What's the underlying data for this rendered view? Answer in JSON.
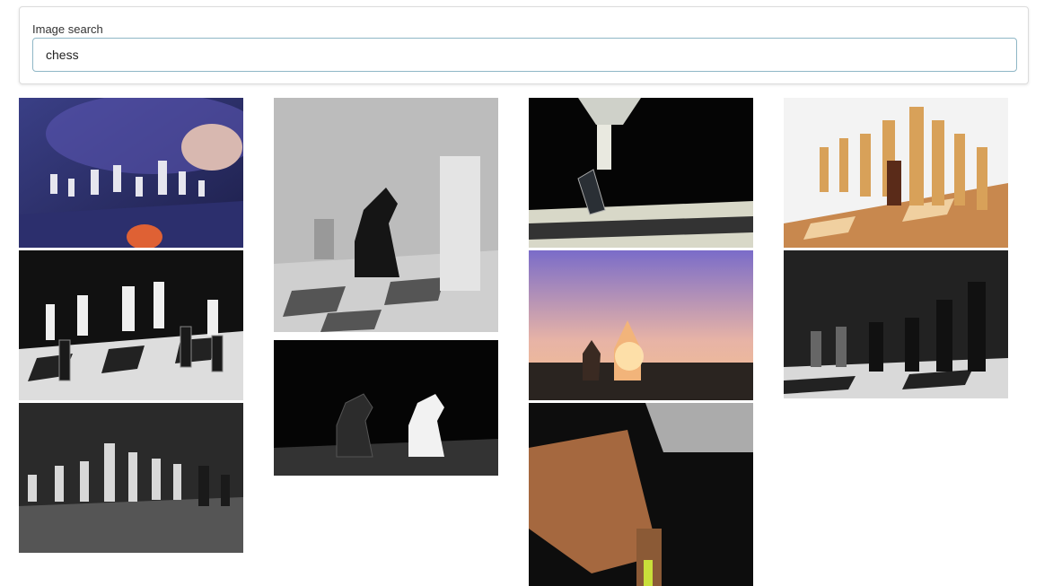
{
  "search": {
    "label": "Image search",
    "value": "chess"
  },
  "results": {
    "images": [
      {
        "subject": "hand-moving-chess-piece-blue-light"
      },
      {
        "subject": "black-and-white-chess-board-pieces"
      },
      {
        "subject": "gray-chess-pieces-blurred"
      },
      {
        "subject": "grayscale-knight-and-pawn"
      },
      {
        "subject": "black-and-white-knights-facing"
      },
      {
        "subject": "queen-dropping-on-king"
      },
      {
        "subject": "sunset-silhouette-chess-pieces"
      },
      {
        "subject": "hand-holding-yellow-piece"
      },
      {
        "subject": "wooden-chess-set"
      },
      {
        "subject": "dark-chess-pieces-board"
      }
    ]
  }
}
